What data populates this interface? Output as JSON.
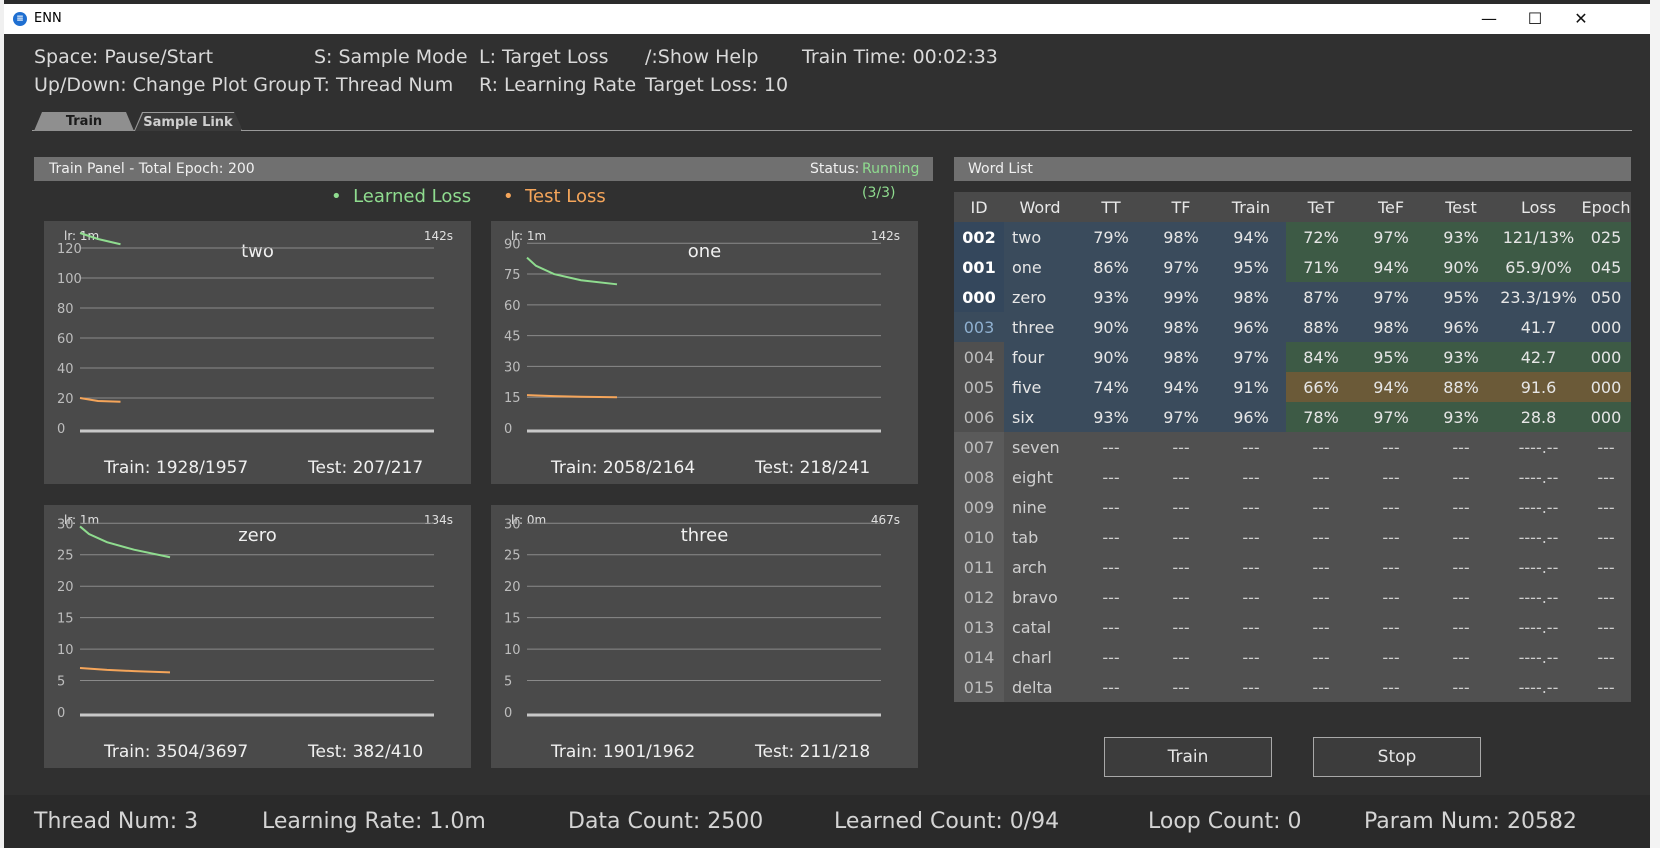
{
  "window": {
    "title": "ENN",
    "icon": "enn-logo-icon",
    "controls": [
      "minimize-icon",
      "maximize-icon",
      "close-icon"
    ],
    "min_glyph": "—",
    "max_glyph": "☐",
    "close_glyph": "✕"
  },
  "hints": {
    "space": "Space: Pause/Start",
    "updown": "Up/Down: Change Plot Group",
    "sample": "S: Sample Mode",
    "thread": "T: Thread Num",
    "target": "L: Target Loss",
    "rate": "R: Learning Rate",
    "help": "/:Show Help",
    "target_loss": "Target Loss: 10",
    "train_time": "Train Time: 00:02:33"
  },
  "tabs": [
    "Train",
    "Sample Link"
  ],
  "train_panel": {
    "title": "Train Panel - Total Epoch: 200",
    "status_label": "Status:",
    "status_value": "Running (3/3)",
    "status_color": "#8fdc8f"
  },
  "legend": {
    "learned": "Learned Loss",
    "test": "Test Loss",
    "learned_color": "#8fdc8f",
    "test_color": "#f5a55a",
    "dot": "•"
  },
  "plots": [
    {
      "title": "two",
      "lr": "lr: 1m",
      "time": "142s",
      "train": "Train: 1928/1957",
      "test": "Test: 207/217",
      "ymax": 130,
      "yticks": [
        0,
        20,
        40,
        60,
        80,
        100,
        120
      ],
      "learned": [
        [
          0,
          130
        ],
        [
          0.2,
          126
        ],
        [
          0.45,
          122.5
        ]
      ],
      "testloss": [
        [
          0,
          20
        ],
        [
          0.2,
          18
        ],
        [
          0.45,
          17.5
        ]
      ]
    },
    {
      "title": "one",
      "lr": "lr: 1m",
      "time": "142s",
      "train": "Train: 2058/2164",
      "test": "Test: 218/241",
      "ymax": 95,
      "yticks": [
        0,
        15,
        30,
        45,
        60,
        75,
        90
      ],
      "learned": [
        [
          0,
          83
        ],
        [
          0.1,
          79
        ],
        [
          0.3,
          75
        ],
        [
          0.6,
          72
        ],
        [
          1,
          70
        ]
      ],
      "testloss": [
        [
          0,
          16
        ],
        [
          0.3,
          15.5
        ],
        [
          0.6,
          15.2
        ],
        [
          1,
          15
        ]
      ]
    },
    {
      "title": "zero",
      "lr": "lr: 1m",
      "time": "134s",
      "train": "Train: 3504/3697",
      "test": "Test: 382/410",
      "ymax": 31,
      "yticks": [
        0,
        5,
        10,
        15,
        20,
        25,
        30
      ],
      "learned": [
        [
          0,
          29.5
        ],
        [
          0.1,
          28.3
        ],
        [
          0.3,
          27
        ],
        [
          0.6,
          25.8
        ],
        [
          1,
          24.6
        ]
      ],
      "testloss": [
        [
          0,
          7
        ],
        [
          0.3,
          6.7
        ],
        [
          0.6,
          6.5
        ],
        [
          1,
          6.3
        ]
      ]
    },
    {
      "title": "three",
      "lr": "lr: 0m",
      "time": "467s",
      "train": "Train: 1901/1962",
      "test": "Test: 211/218",
      "ymax": 31,
      "yticks": [
        0,
        5,
        10,
        15,
        20,
        25,
        30
      ],
      "learned": [],
      "testloss": []
    }
  ],
  "word_list": {
    "title": "Word List",
    "columns": [
      "ID",
      "Word",
      "TT",
      "TF",
      "Train",
      "TeT",
      "TeF",
      "Test",
      "Loss",
      "Epoch"
    ],
    "colors": {
      "active_id": "#34475c",
      "row": "#3a4b5c",
      "good": "#3d5a45",
      "warn": "#6b5a38",
      "idle": "#505050",
      "idle_id": "#5a5a5a"
    },
    "rows": [
      {
        "id": "002",
        "word": "two",
        "tt": "79%",
        "tf": "98%",
        "train": "94%",
        "tet": "72%",
        "tef": "97%",
        "test": "93%",
        "loss": "121/13%",
        "epoch": "025",
        "state": "active",
        "tone": "good"
      },
      {
        "id": "001",
        "word": "one",
        "tt": "86%",
        "tf": "97%",
        "train": "95%",
        "tet": "71%",
        "tef": "94%",
        "test": "90%",
        "loss": "65.9/0%",
        "epoch": "045",
        "state": "active",
        "tone": "good"
      },
      {
        "id": "000",
        "word": "zero",
        "tt": "93%",
        "tf": "99%",
        "train": "98%",
        "tet": "87%",
        "tef": "97%",
        "test": "95%",
        "loss": "23.3/19%",
        "epoch": "050",
        "state": "active",
        "tone": "row"
      },
      {
        "id": "003",
        "word": "three",
        "tt": "90%",
        "tf": "98%",
        "train": "96%",
        "tet": "88%",
        "tef": "98%",
        "test": "96%",
        "loss": "41.7",
        "epoch": "000",
        "state": "done",
        "tone": "row"
      },
      {
        "id": "004",
        "word": "four",
        "tt": "90%",
        "tf": "98%",
        "train": "97%",
        "tet": "84%",
        "tef": "95%",
        "test": "93%",
        "loss": "42.7",
        "epoch": "000",
        "state": "queued",
        "tone": "good"
      },
      {
        "id": "005",
        "word": "five",
        "tt": "74%",
        "tf": "94%",
        "train": "91%",
        "tet": "66%",
        "tef": "94%",
        "test": "88%",
        "loss": "91.6",
        "epoch": "000",
        "state": "queued",
        "tone": "warn"
      },
      {
        "id": "006",
        "word": "six",
        "tt": "93%",
        "tf": "97%",
        "train": "96%",
        "tet": "78%",
        "tef": "97%",
        "test": "93%",
        "loss": "28.8",
        "epoch": "000",
        "state": "queued",
        "tone": "good"
      },
      {
        "id": "007",
        "word": "seven",
        "tt": "---",
        "tf": "---",
        "train": "---",
        "tet": "---",
        "tef": "---",
        "test": "---",
        "loss": "----.--",
        "epoch": "---",
        "state": "idle",
        "tone": "idle"
      },
      {
        "id": "008",
        "word": "eight",
        "tt": "---",
        "tf": "---",
        "train": "---",
        "tet": "---",
        "tef": "---",
        "test": "---",
        "loss": "----.--",
        "epoch": "---",
        "state": "idle",
        "tone": "idle"
      },
      {
        "id": "009",
        "word": "nine",
        "tt": "---",
        "tf": "---",
        "train": "---",
        "tet": "---",
        "tef": "---",
        "test": "---",
        "loss": "----.--",
        "epoch": "---",
        "state": "idle",
        "tone": "idle"
      },
      {
        "id": "010",
        "word": "tab",
        "tt": "---",
        "tf": "---",
        "train": "---",
        "tet": "---",
        "tef": "---",
        "test": "---",
        "loss": "----.--",
        "epoch": "---",
        "state": "idle",
        "tone": "idle"
      },
      {
        "id": "011",
        "word": "arch",
        "tt": "---",
        "tf": "---",
        "train": "---",
        "tet": "---",
        "tef": "---",
        "test": "---",
        "loss": "----.--",
        "epoch": "---",
        "state": "idle",
        "tone": "idle"
      },
      {
        "id": "012",
        "word": "bravo",
        "tt": "---",
        "tf": "---",
        "train": "---",
        "tet": "---",
        "tef": "---",
        "test": "---",
        "loss": "----.--",
        "epoch": "---",
        "state": "idle",
        "tone": "idle"
      },
      {
        "id": "013",
        "word": "catal",
        "tt": "---",
        "tf": "---",
        "train": "---",
        "tet": "---",
        "tef": "---",
        "test": "---",
        "loss": "----.--",
        "epoch": "---",
        "state": "idle",
        "tone": "idle"
      },
      {
        "id": "014",
        "word": "charl",
        "tt": "---",
        "tf": "---",
        "train": "---",
        "tet": "---",
        "tef": "---",
        "test": "---",
        "loss": "----.--",
        "epoch": "---",
        "state": "idle",
        "tone": "idle"
      },
      {
        "id": "015",
        "word": "delta",
        "tt": "---",
        "tf": "---",
        "train": "---",
        "tet": "---",
        "tef": "---",
        "test": "---",
        "loss": "----.--",
        "epoch": "---",
        "state": "idle",
        "tone": "idle"
      }
    ]
  },
  "buttons": {
    "train": "Train",
    "stop": "Stop"
  },
  "status_bar": {
    "thread": "Thread Num: 3",
    "rate": "Learning Rate: 1.0m",
    "data": "Data Count: 2500",
    "learned": "Learned Count: 0/94",
    "loop": "Loop Count: 0",
    "param": "Param Num: 20582"
  }
}
